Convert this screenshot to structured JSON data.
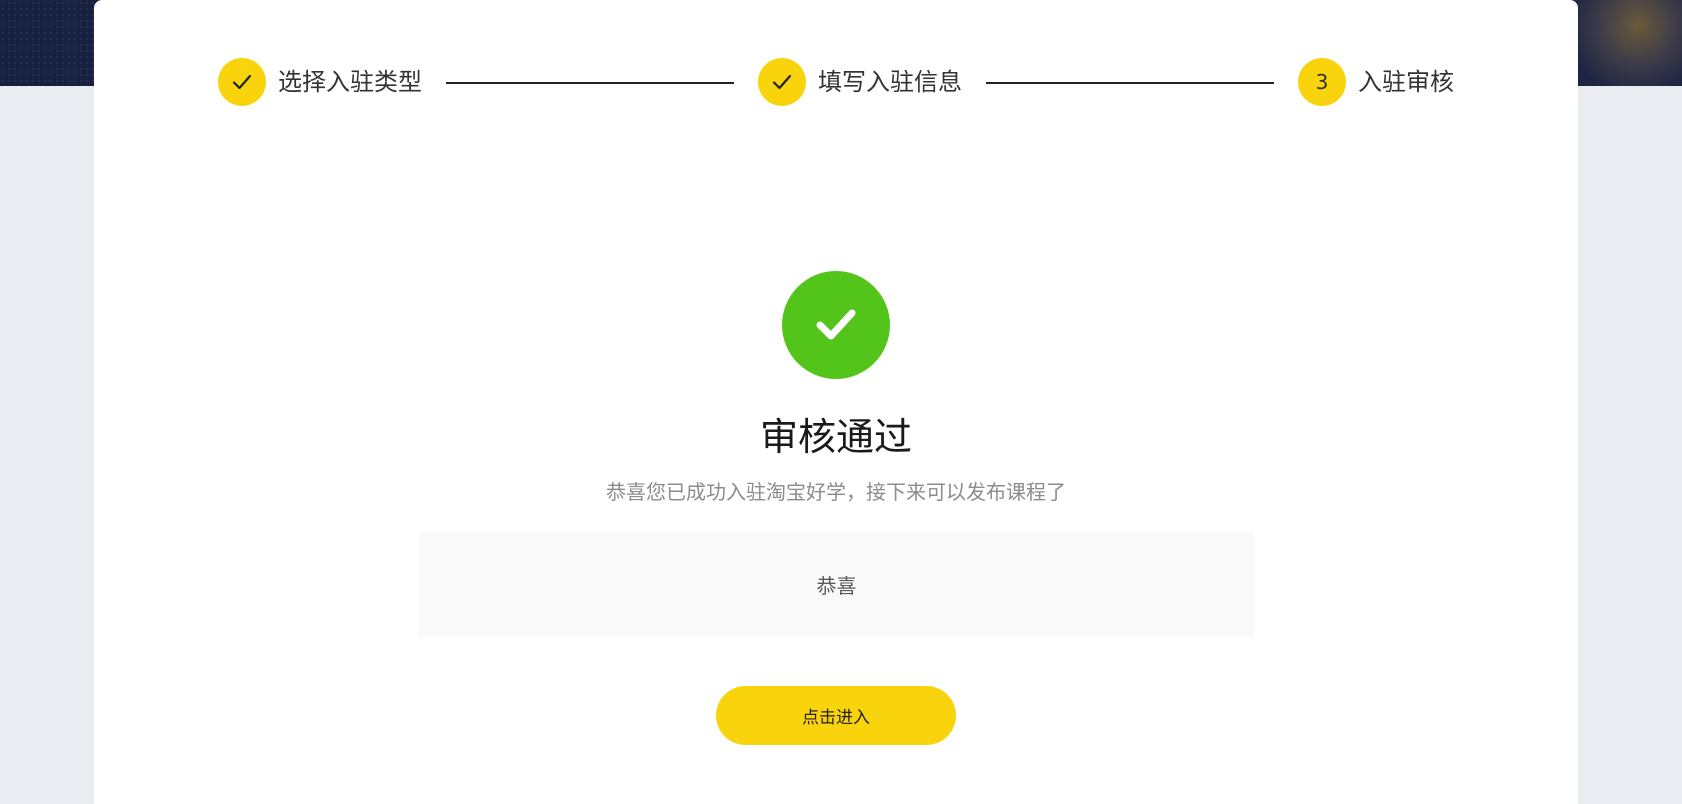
{
  "stepper": {
    "steps": [
      {
        "label": "选择入驻类型",
        "status": "done",
        "icon": "check-icon"
      },
      {
        "label": "填写入驻信息",
        "status": "done",
        "icon": "check-icon"
      },
      {
        "label": "入驻审核",
        "status": "current",
        "number": "3"
      }
    ]
  },
  "result": {
    "icon": "success-check-icon",
    "title": "审核通过",
    "subtitle": "恭喜您已成功入驻淘宝好学，接下来可以发布课程了",
    "notice": "恭喜",
    "button_label": "点击进入"
  },
  "colors": {
    "accent": "#f9d30b",
    "success": "#52c41a",
    "banner": "#1d2748"
  }
}
